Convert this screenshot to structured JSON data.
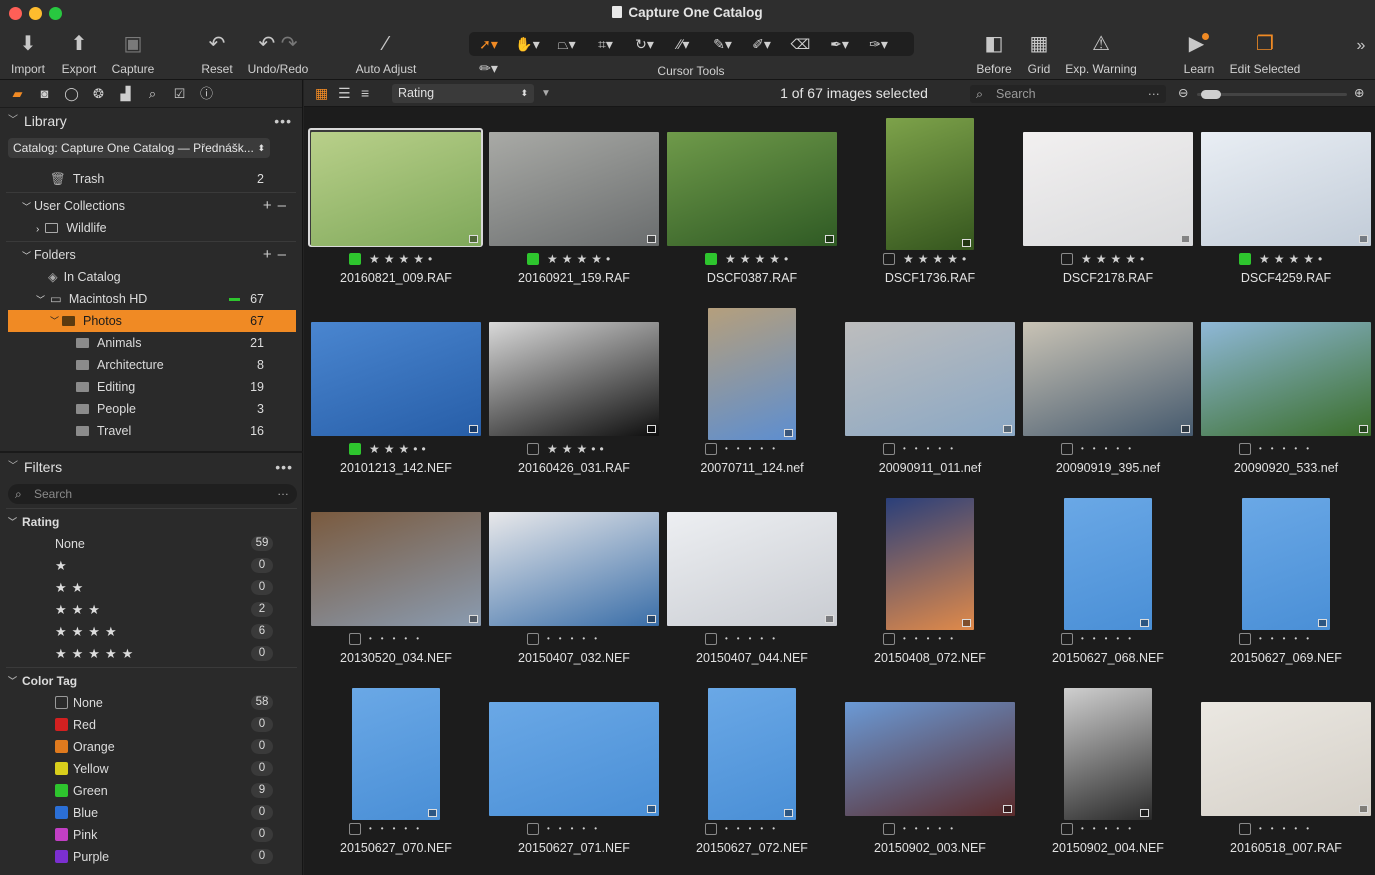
{
  "window": {
    "title": "Capture One Catalog"
  },
  "toolbar": {
    "import": "Import",
    "export": "Export",
    "capture": "Capture",
    "reset": "Reset",
    "undo_redo": "Undo/Redo",
    "auto_adjust": "Auto Adjust",
    "cursor_tools": "Cursor Tools",
    "before": "Before",
    "grid": "Grid",
    "exp_warning": "Exp. Warning",
    "learn": "Learn",
    "edit_selected": "Edit Selected"
  },
  "library": {
    "title": "Library",
    "catalog": "Catalog: Capture One Catalog — Přednášk...",
    "trash": {
      "label": "Trash",
      "count": "2"
    },
    "user_collections": "User Collections",
    "wildlife": "Wildlife",
    "folders": "Folders",
    "in_catalog": "In Catalog",
    "macintosh": {
      "label": "Macintosh HD",
      "count": "67"
    },
    "photos": {
      "label": "Photos",
      "count": "67"
    },
    "subfolders": [
      {
        "label": "Animals",
        "count": "21"
      },
      {
        "label": "Architecture",
        "count": "8"
      },
      {
        "label": "Editing",
        "count": "19"
      },
      {
        "label": "People",
        "count": "3"
      },
      {
        "label": "Travel",
        "count": "16"
      }
    ]
  },
  "filters": {
    "title": "Filters",
    "search_placeholder": "Search",
    "rating_title": "Rating",
    "ratings": [
      {
        "label": "None",
        "count": "59"
      },
      {
        "label": "★",
        "count": "0"
      },
      {
        "label": "★★",
        "count": "0"
      },
      {
        "label": "★★★",
        "count": "2"
      },
      {
        "label": "★★★★",
        "count": "6"
      },
      {
        "label": "★★★★★",
        "count": "0"
      }
    ],
    "color_tag_title": "Color Tag",
    "color_tags": [
      {
        "label": "None",
        "count": "58",
        "color": "none"
      },
      {
        "label": "Red",
        "count": "0",
        "color": "#d32020"
      },
      {
        "label": "Orange",
        "count": "0",
        "color": "#e07a1e"
      },
      {
        "label": "Yellow",
        "count": "0",
        "color": "#d9cf1c"
      },
      {
        "label": "Green",
        "count": "9",
        "color": "#2ec52e"
      },
      {
        "label": "Blue",
        "count": "0",
        "color": "#2b6fd6"
      },
      {
        "label": "Pink",
        "count": "0",
        "color": "#c23fc4"
      },
      {
        "label": "Purple",
        "count": "0",
        "color": "#7b2fd0"
      }
    ]
  },
  "viewer": {
    "sort": "Rating",
    "selection": "1 of 67 images selected",
    "search_placeholder": "Search"
  },
  "images": [
    {
      "name": "20160821_009.RAF",
      "stars": 4,
      "green": true,
      "selected": true,
      "subject": "sparrow among green reeds",
      "colors": [
        "#7fa85a",
        "#b9d08a"
      ]
    },
    {
      "name": "20160921_159.RAF",
      "stars": 4,
      "green": true,
      "subject": "arctic fox on rocks",
      "colors": [
        "#6a6d6e",
        "#a9aaa6"
      ]
    },
    {
      "name": "DSCF0387.RAF",
      "stars": 4,
      "green": true,
      "subject": "dark bird in green foliage",
      "colors": [
        "#2f5a24",
        "#6f9a4a"
      ]
    },
    {
      "name": "DSCF1736.RAF",
      "stars": 4,
      "green": false,
      "subject": "finch on branch",
      "colors": [
        "#35561e",
        "#7da24a"
      ]
    },
    {
      "name": "DSCF2178.RAF",
      "stars": 4,
      "green": false,
      "subject": "bird landing in snow",
      "colors": [
        "#d9dadc",
        "#f2f0f0"
      ]
    },
    {
      "name": "DSCF4259.RAF",
      "stars": 4,
      "green": true,
      "subject": "snowy mountain landscape",
      "colors": [
        "#c2ccd8",
        "#e9eef4"
      ]
    },
    {
      "name": "20101213_142.NEF",
      "stars": 3,
      "green": true,
      "subject": "eagle in flight",
      "colors": [
        "#275ea8",
        "#4a86d0"
      ]
    },
    {
      "name": "20160426_031.RAF",
      "stars": 3,
      "green": false,
      "subject": "snowy peak with moon",
      "colors": [
        "#0e0e0e",
        "#d9d9d9"
      ]
    },
    {
      "name": "20070711_124.nef",
      "stars": 0,
      "green": false,
      "subject": "stone bell tower",
      "colors": [
        "#5d8ed0",
        "#b59f7c"
      ]
    },
    {
      "name": "20090911_011.nef",
      "stars": 0,
      "green": false,
      "subject": "town square buildings",
      "colors": [
        "#8aa7c4",
        "#bdbdbd"
      ]
    },
    {
      "name": "20090919_395.nef",
      "stars": 0,
      "green": false,
      "subject": "rally car on street",
      "colors": [
        "#465a6e",
        "#c9c3b5"
      ]
    },
    {
      "name": "20090920_533.nef",
      "stars": 0,
      "green": false,
      "subject": "green mountain valley",
      "colors": [
        "#3a6e2a",
        "#8fb8d8"
      ]
    },
    {
      "name": "20130520_034.NEF",
      "stars": 0,
      "green": false,
      "subject": "cloudy sky over hills",
      "colors": [
        "#8a9bb0",
        "#7a5a3e"
      ]
    },
    {
      "name": "20150407_032.NEF",
      "stars": 0,
      "green": false,
      "subject": "walrus on ice",
      "colors": [
        "#3a6ea8",
        "#e8e8ea"
      ]
    },
    {
      "name": "20150407_044.NEF",
      "stars": 0,
      "green": false,
      "subject": "arctic fox in snow",
      "colors": [
        "#c9ccd2",
        "#edeff2"
      ]
    },
    {
      "name": "20150408_072.NEF",
      "stars": 0,
      "green": false,
      "subject": "radio tower at sunset",
      "colors": [
        "#e08a4a",
        "#2a3f7a"
      ]
    },
    {
      "name": "20150627_068.NEF",
      "stars": 0,
      "green": false,
      "subject": "bird on branch blue sky",
      "colors": [
        "#4a8fd6",
        "#6aa8e6"
      ]
    },
    {
      "name": "20150627_069.NEF",
      "stars": 0,
      "green": false,
      "subject": "bird on branch blue sky",
      "colors": [
        "#4a8fd6",
        "#6aa8e6"
      ]
    },
    {
      "name": "20150627_070.NEF",
      "stars": 0,
      "green": false,
      "subject": "bird on branch blue sky",
      "colors": [
        "#4a8fd6",
        "#6aa8e6"
      ]
    },
    {
      "name": "20150627_071.NEF",
      "stars": 0,
      "green": false,
      "subject": "bird on branch blue sky",
      "colors": [
        "#4a8fd6",
        "#6aa8e6"
      ]
    },
    {
      "name": "20150627_072.NEF",
      "stars": 0,
      "green": false,
      "subject": "bird on branch blue sky",
      "colors": [
        "#4a8fd6",
        "#6aa8e6"
      ]
    },
    {
      "name": "20150902_003.NEF",
      "stars": 0,
      "green": false,
      "subject": "curved building facade",
      "colors": [
        "#5a2a2a",
        "#6b9ad6"
      ]
    },
    {
      "name": "20150902_004.NEF",
      "stars": 0,
      "green": false,
      "subject": "black and white skyscraper",
      "colors": [
        "#2a2a2a",
        "#cfcfcf"
      ]
    },
    {
      "name": "20160518_007.RAF",
      "stars": 0,
      "green": false,
      "subject": "duckling in snow",
      "colors": [
        "#d5d0c8",
        "#ebe8e2"
      ]
    }
  ]
}
